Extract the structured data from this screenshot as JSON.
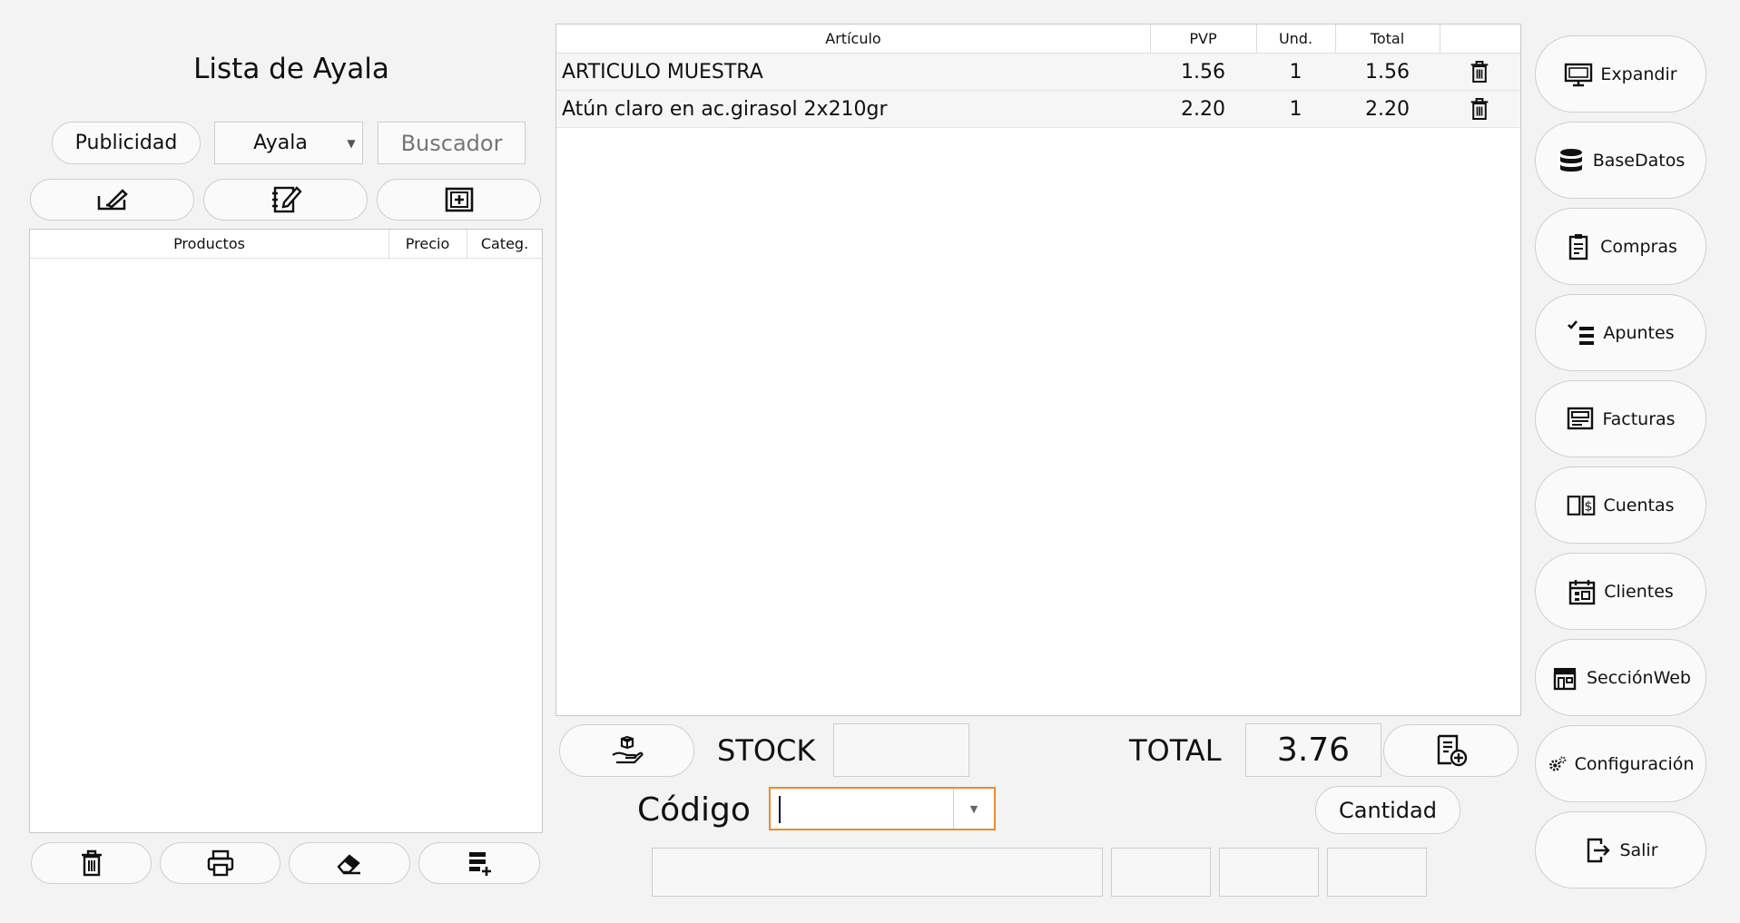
{
  "left": {
    "title": "Lista de Ayala",
    "publicidad_label": "Publicidad",
    "selected_list": "Ayala",
    "search_placeholder": "Buscador",
    "products_table": {
      "headers": [
        "Productos",
        "Precio",
        "Categ."
      ],
      "rows": []
    }
  },
  "cart": {
    "headers": {
      "articulo": "Artículo",
      "pvp": "PVP",
      "und": "Und.",
      "total": "Total"
    },
    "rows": [
      {
        "articulo": "ARTICULO MUESTRA",
        "pvp": "1.56",
        "und": "1",
        "total": "1.56"
      },
      {
        "articulo": "Atún claro en ac.girasol 2x210gr",
        "pvp": "2.20",
        "und": "1",
        "total": "2.20"
      }
    ]
  },
  "bottom": {
    "stock_label": "STOCK",
    "stock_value": "",
    "total_label": "TOTAL",
    "total_value": "3.76",
    "codigo_label": "Código",
    "codigo_value": "",
    "cantidad_label": "Cantidad"
  },
  "sidebar": {
    "items": [
      {
        "label": "Expandir",
        "icon": "monitor-icon"
      },
      {
        "label": "BaseDatos",
        "icon": "database-icon"
      },
      {
        "label": "Compras",
        "icon": "clipboard-icon"
      },
      {
        "label": "Apuntes",
        "icon": "checklist-icon"
      },
      {
        "label": "Facturas",
        "icon": "invoice-icon"
      },
      {
        "label": "Cuentas",
        "icon": "ledger-icon"
      },
      {
        "label": "Clientes",
        "icon": "calendar-icon"
      },
      {
        "label": "SecciónWeb",
        "icon": "store-icon"
      },
      {
        "label": "Configuración",
        "icon": "gears-icon"
      },
      {
        "label": "Salir",
        "icon": "exit-icon"
      }
    ]
  },
  "colors": {
    "background": "#f3f3f3",
    "focus_border": "#f08a2a",
    "panel": "#ffffff"
  }
}
